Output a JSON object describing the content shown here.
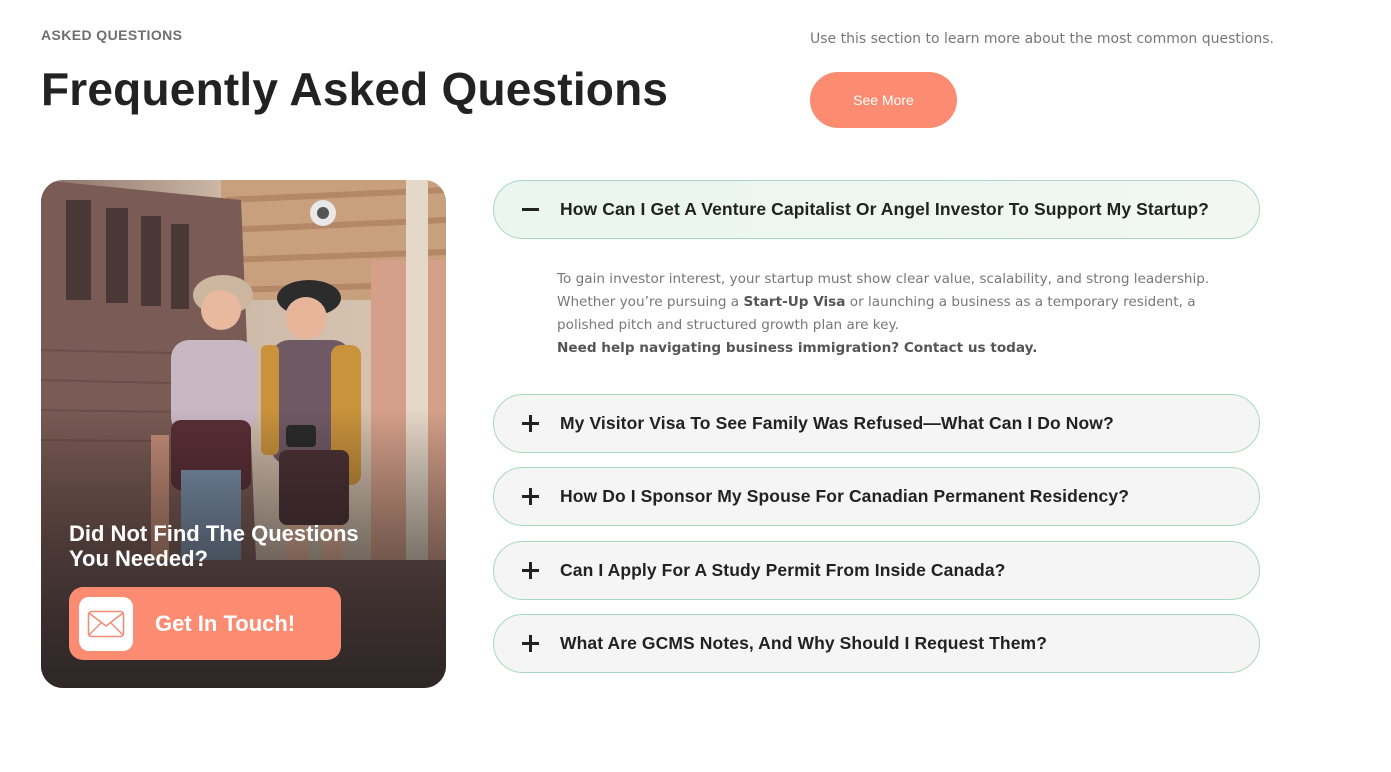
{
  "header": {
    "eyebrow": "ASKED QUESTIONS",
    "title": "Frequently Asked Questions",
    "intro": "Use this section to learn more about the most common questions.",
    "see_more_label": "See More"
  },
  "promo": {
    "heading": "Did Not Find The Questions You Needed?",
    "button_label": "Get In Touch!",
    "icon": "envelope-icon"
  },
  "faq": {
    "items": [
      {
        "question": "How Can I Get A Venture Capitalist Or Angel Investor To Support My Startup?",
        "expanded": true,
        "icon": "minus-icon"
      },
      {
        "question": "My Visitor Visa To See Family Was Refused—What Can I Do Now?",
        "expanded": false,
        "icon": "plus-icon"
      },
      {
        "question": "How Do I Sponsor My Spouse For Canadian Permanent Residency?",
        "expanded": false,
        "icon": "plus-icon"
      },
      {
        "question": "Can I Apply For A Study Permit From Inside Canada?",
        "expanded": false,
        "icon": "plus-icon"
      },
      {
        "question": "What Are GCMS Notes, And Why Should I Request Them?",
        "expanded": false,
        "icon": "plus-icon"
      }
    ],
    "answer": {
      "line1": "To gain investor interest, your startup must show clear value, scalability, and strong leadership.",
      "line2_before": "Whether you’re pursuing a ",
      "line2_bold": "Start-Up Visa",
      "line2_after": " or launching a business as a temporary resident, a polished pitch and structured growth plan are key.",
      "cta": "Need help navigating business immigration? Contact us today."
    }
  },
  "colors": {
    "accent": "#fb8c72",
    "border": "#a9d8c2",
    "item_bg": "#f5f5f5"
  }
}
